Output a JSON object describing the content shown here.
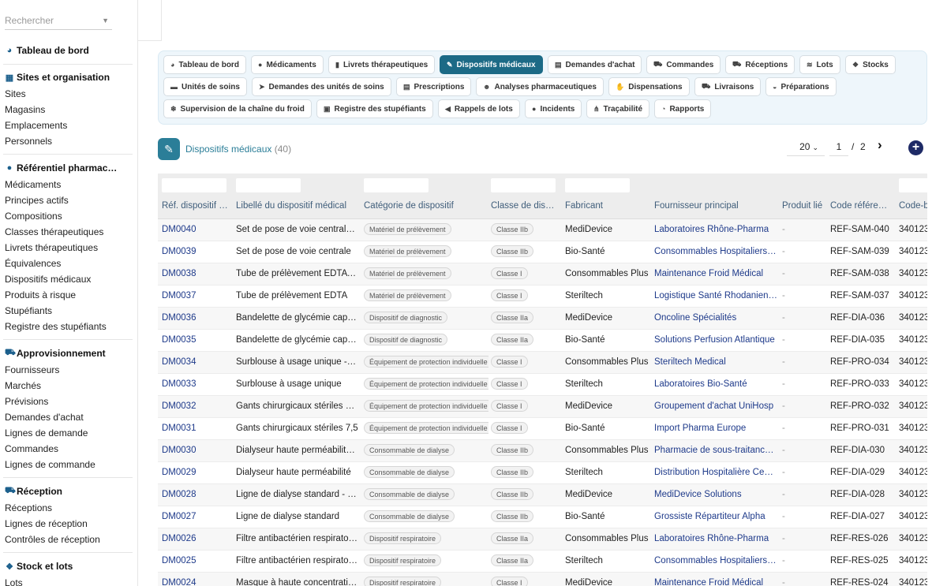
{
  "sidebar": {
    "search_placeholder": "Rechercher",
    "dashboard": "Tableau de bord",
    "sections": [
      {
        "title": "Sites et organisation",
        "icon": "building-icon",
        "items": [
          "Sites",
          "Magasins",
          "Emplacements",
          "Personnels"
        ]
      },
      {
        "title": "Référentiel pharmac…",
        "icon": "pills-icon",
        "items": [
          "Médicaments",
          "Principes actifs",
          "Compositions",
          "Classes thérapeutiques",
          "Livrets thérapeutiques",
          "Équivalences",
          "Dispositifs médicaux",
          "Produits à risque",
          "Stupéfiants",
          "Registre des stupéfiants"
        ]
      },
      {
        "title": "Approvisionnement",
        "icon": "cart-icon",
        "items": [
          "Fournisseurs",
          "Marchés",
          "Prévisions",
          "Demandes d'achat",
          "Lignes de demande",
          "Commandes",
          "Lignes de commande"
        ]
      },
      {
        "title": "Réception",
        "icon": "truck-icon",
        "items": [
          "Réceptions",
          "Lignes de réception",
          "Contrôles de réception"
        ]
      },
      {
        "title": "Stock et lots",
        "icon": "boxes-icon",
        "items": [
          "Lots"
        ]
      }
    ]
  },
  "tabs": [
    {
      "label": "Tableau de bord",
      "icon": "gauge-icon"
    },
    {
      "label": "Médicaments",
      "icon": "pills-icon"
    },
    {
      "label": "Livrets thérapeutiques",
      "icon": "book-icon"
    },
    {
      "label": "Dispositifs médicaux",
      "icon": "syringe-icon",
      "active": true
    },
    {
      "label": "Demandes d'achat",
      "icon": "file-icon"
    },
    {
      "label": "Commandes",
      "icon": "cart-icon"
    },
    {
      "label": "Réceptions",
      "icon": "truck-icon"
    },
    {
      "label": "Lots",
      "icon": "layers-icon"
    },
    {
      "label": "Stocks",
      "icon": "cubes-icon"
    },
    {
      "label": "Unités de soins",
      "icon": "bed-icon"
    },
    {
      "label": "Demandes des unités de soins",
      "icon": "send-icon"
    },
    {
      "label": "Prescriptions",
      "icon": "prescription-icon"
    },
    {
      "label": "Analyses pharmaceutiques",
      "icon": "user-check-icon"
    },
    {
      "label": "Dispensations",
      "icon": "hand-icon"
    },
    {
      "label": "Livraisons",
      "icon": "delivery-icon"
    },
    {
      "label": "Préparations",
      "icon": "mortar-icon"
    },
    {
      "label": "Supervision de la chaîne du froid",
      "icon": "snowflake-icon"
    },
    {
      "label": "Registre des stupéfiants",
      "icon": "lock-icon"
    },
    {
      "label": "Rappels de lots",
      "icon": "megaphone-icon"
    },
    {
      "label": "Incidents",
      "icon": "alert-icon"
    },
    {
      "label": "Traçabilité",
      "icon": "network-icon"
    },
    {
      "label": "Rapports",
      "icon": "chart-pie-icon"
    }
  ],
  "header": {
    "title": "Dispositifs médicaux",
    "count": "(40)",
    "page_size": "20",
    "page": "1",
    "page_sep": "/",
    "page_total": "2"
  },
  "table": {
    "columns": [
      "Réf. dispositif …",
      "Libellé du dispositif médical",
      "Catégorie de dispositif",
      "Classe de dis…",
      "Fabricant",
      "Fournisseur principal",
      "Produit lié",
      "Code référe…",
      "Code-b"
    ],
    "rows": [
      {
        "ref": "DM0040",
        "libelle": "Set de pose de voie central…",
        "cat": "Matériel de prélèvement",
        "classe": "Classe IIb",
        "fab": "MediDevice",
        "four": "Laboratoires Rhône-Pharma",
        "prod": "-",
        "code": "REF-SAM-040",
        "cb": "340123"
      },
      {
        "ref": "DM0039",
        "libelle": "Set de pose de voie centrale",
        "cat": "Matériel de prélèvement",
        "classe": "Classe IIb",
        "fab": "Bio-Santé",
        "four": "Consommables Hospitaliers…",
        "prod": "-",
        "code": "REF-SAM-039",
        "cb": "340123"
      },
      {
        "ref": "DM0038",
        "libelle": "Tube de prélèvement EDTA …",
        "cat": "Matériel de prélèvement",
        "classe": "Classe I",
        "fab": "Consommables Plus",
        "four": "Maintenance Froid Médical",
        "prod": "-",
        "code": "REF-SAM-038",
        "cb": "340123"
      },
      {
        "ref": "DM0037",
        "libelle": "Tube de prélèvement EDTA",
        "cat": "Matériel de prélèvement",
        "classe": "Classe I",
        "fab": "Steriltech",
        "four": "Logistique Santé Rhodanien…",
        "prod": "-",
        "code": "REF-SAM-037",
        "cb": "340123"
      },
      {
        "ref": "DM0036",
        "libelle": "Bandelette de glycémie capi…",
        "cat": "Dispositif de diagnostic",
        "classe": "Classe IIa",
        "fab": "MediDevice",
        "four": "Oncoline Spécialités",
        "prod": "-",
        "code": "REF-DIA-036",
        "cb": "340123"
      },
      {
        "ref": "DM0035",
        "libelle": "Bandelette de glycémie capi…",
        "cat": "Dispositif de diagnostic",
        "classe": "Classe IIa",
        "fab": "Bio-Santé",
        "four": "Solutions Perfusion Atlantique",
        "prod": "-",
        "code": "REF-DIA-035",
        "cb": "340123"
      },
      {
        "ref": "DM0034",
        "libelle": "Surblouse à usage unique - …",
        "cat": "Équipement de protection individuelle",
        "classe": "Classe I",
        "fab": "Consommables Plus",
        "four": "Steriltech Medical",
        "prod": "-",
        "code": "REF-PRO-034",
        "cb": "340123"
      },
      {
        "ref": "DM0033",
        "libelle": "Surblouse à usage unique",
        "cat": "Équipement de protection individuelle",
        "classe": "Classe I",
        "fab": "Steriltech",
        "four": "Laboratoires Bio-Santé",
        "prod": "-",
        "code": "REF-PRO-033",
        "cb": "340123"
      },
      {
        "ref": "DM0032",
        "libelle": "Gants chirurgicaux stériles …",
        "cat": "Équipement de protection individuelle",
        "classe": "Classe I",
        "fab": "MediDevice",
        "four": "Groupement d'achat UniHosp",
        "prod": "-",
        "code": "REF-PRO-032",
        "cb": "340123"
      },
      {
        "ref": "DM0031",
        "libelle": "Gants chirurgicaux stériles 7,5",
        "cat": "Équipement de protection individuelle",
        "classe": "Classe I",
        "fab": "Bio-Santé",
        "four": "Import Pharma Europe",
        "prod": "-",
        "code": "REF-PRO-031",
        "cb": "340123"
      },
      {
        "ref": "DM0030",
        "libelle": "Dialyseur haute perméabilit…",
        "cat": "Consommable de dialyse",
        "classe": "Classe IIb",
        "fab": "Consommables Plus",
        "four": "Pharmacie de sous-traitanc…",
        "prod": "-",
        "code": "REF-DIA-030",
        "cb": "340123"
      },
      {
        "ref": "DM0029",
        "libelle": "Dialyseur haute perméabilité",
        "cat": "Consommable de dialyse",
        "classe": "Classe IIb",
        "fab": "Steriltech",
        "four": "Distribution Hospitalière Ce…",
        "prod": "-",
        "code": "REF-DIA-029",
        "cb": "340123"
      },
      {
        "ref": "DM0028",
        "libelle": "Ligne de dialyse standard - …",
        "cat": "Consommable de dialyse",
        "classe": "Classe IIb",
        "fab": "MediDevice",
        "four": "MediDevice Solutions",
        "prod": "-",
        "code": "REF-DIA-028",
        "cb": "340123"
      },
      {
        "ref": "DM0027",
        "libelle": "Ligne de dialyse standard",
        "cat": "Consommable de dialyse",
        "classe": "Classe IIb",
        "fab": "Bio-Santé",
        "four": "Grossiste Répartiteur Alpha",
        "prod": "-",
        "code": "REF-DIA-027",
        "cb": "340123"
      },
      {
        "ref": "DM0026",
        "libelle": "Filtre antibactérien respirato…",
        "cat": "Dispositif respiratoire",
        "classe": "Classe IIa",
        "fab": "Consommables Plus",
        "four": "Laboratoires Rhône-Pharma",
        "prod": "-",
        "code": "REF-RES-026",
        "cb": "340123"
      },
      {
        "ref": "DM0025",
        "libelle": "Filtre antibactérien respiratoire",
        "cat": "Dispositif respiratoire",
        "classe": "Classe IIa",
        "fab": "Steriltech",
        "four": "Consommables Hospitaliers…",
        "prod": "-",
        "code": "REF-RES-025",
        "cb": "340123"
      },
      {
        "ref": "DM0024",
        "libelle": "Masque à haute concentrati…",
        "cat": "Dispositif respiratoire",
        "classe": "Classe I",
        "fab": "MediDevice",
        "four": "Maintenance Froid Médical",
        "prod": "-",
        "code": "REF-RES-024",
        "cb": "340123"
      }
    ]
  }
}
